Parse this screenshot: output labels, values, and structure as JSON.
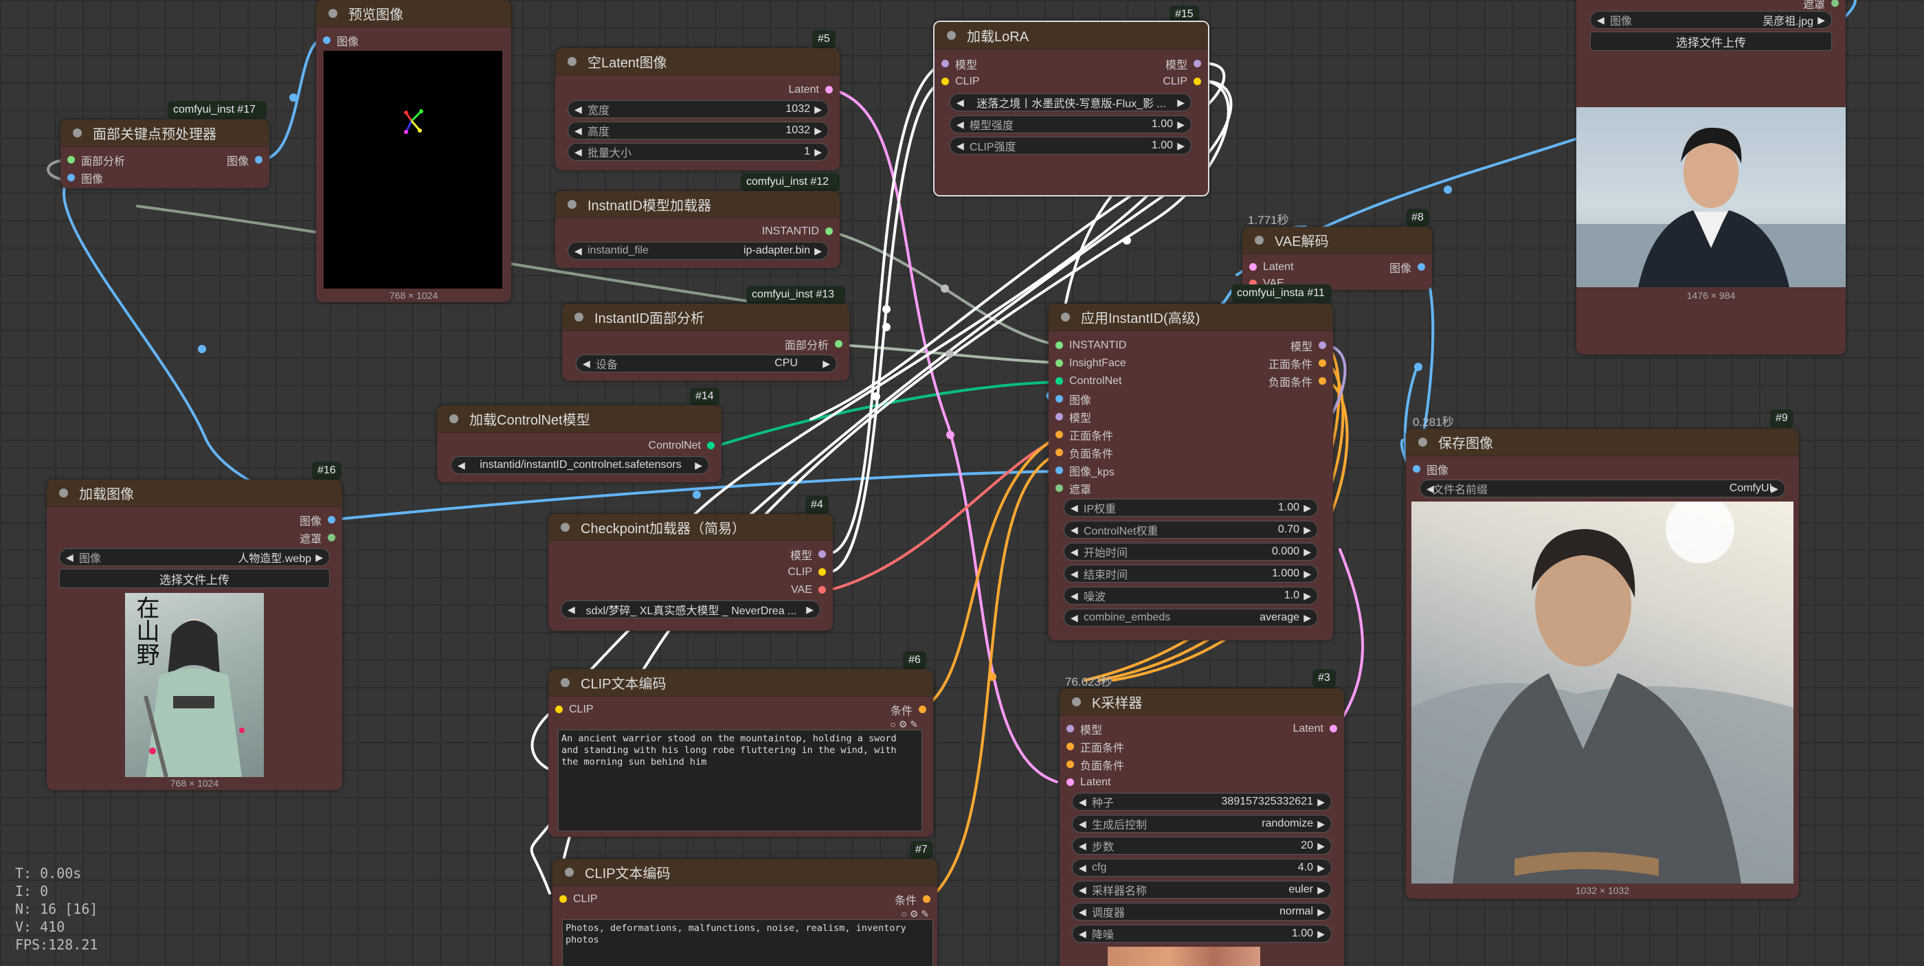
{
  "sockets": {
    "face_analysis": "面部分析",
    "image": "图像",
    "latent": "Latent",
    "instantid": "INSTANTID",
    "model": "模型",
    "clip": "CLIP",
    "vae": "VAE",
    "controlnet": "ControlNet",
    "mask": "遮罩",
    "positive": "正面条件",
    "negative": "负面条件",
    "insightface": "InsightFace",
    "image_kps": "图像_kps",
    "conditioning": "条件"
  },
  "n17": {
    "title": "面部关键点预处理器",
    "badge": "comfyui_inst #17"
  },
  "preview": {
    "title": "预览图像",
    "cap": "768 × 1024"
  },
  "n5": {
    "title": "空Latent图像",
    "badge": "#5",
    "width_l": "宽度",
    "width_v": "1032",
    "height_l": "高度",
    "height_v": "1032",
    "batch_l": "批量大小",
    "batch_v": "1"
  },
  "n12": {
    "title": "InstnatID模型加载器",
    "badge": "comfyui_inst #12",
    "file_l": "instantid_file",
    "file_v": "ip-adapter.bin"
  },
  "n13": {
    "title": "InstantID面部分析",
    "badge": "comfyui_inst #13",
    "dev_l": "设备",
    "dev_v": "CPU"
  },
  "n14": {
    "title": "加载ControlNet模型",
    "badge": "#14",
    "cn_v": "instantid/instantID_controlnet.safetensors"
  },
  "n16": {
    "title": "加载图像",
    "badge": "#16",
    "img_l": "图像",
    "img_v": "人物造型.webp",
    "upload": "选择文件上传",
    "cap": "768 × 1024",
    "poster": "在山野"
  },
  "n4": {
    "title": "Checkpoint加载器（简易）",
    "badge": "#4",
    "ckpt": "sdxl/梦碎_ XL真实感大模型 _ NeverDrea ..."
  },
  "n15": {
    "title": "加载LoRA",
    "badge": "#15",
    "lora": "迷落之境丨水墨武侠-写意版-Flux_影 ...",
    "ms_l": "模型强度",
    "ms_v": "1.00",
    "cs_l": "CLIP强度",
    "cs_v": "1.00"
  },
  "n6": {
    "title": "CLIP文本编码",
    "badge": "#6",
    "text": "An ancient warrior stood on the mountaintop, holding a sword and standing with his long robe fluttering in the wind, with the morning sun behind him"
  },
  "n7": {
    "title": "CLIP文本编码",
    "badge": "#7",
    "text": "Photos, deformations, malfunctions, noise, realism, inventory photos"
  },
  "n8": {
    "title": "VAE解码",
    "badge": "#8",
    "timing": "1.771秒"
  },
  "n11": {
    "title": "应用InstantID(高级)",
    "badge": "comfyui_insta #11",
    "ip_l": "IP权重",
    "ip_v": "1.00",
    "cnw_l": "ControlNet权重",
    "cnw_v": "0.70",
    "st_l": "开始时间",
    "st_v": "0.000",
    "et_l": "结束时间",
    "et_v": "1.000",
    "noise_l": "噪波",
    "noise_v": "1.0",
    "ce_l": "combine_embeds",
    "ce_v": "average"
  },
  "n3": {
    "title": "K采样器",
    "badge": "#3",
    "timing": "76.623秒",
    "seed_l": "种子",
    "seed_v": "389157325332621",
    "ctl_l": "生成后控制",
    "ctl_v": "randomize",
    "steps_l": "步数",
    "steps_v": "20",
    "cfg_l": "cfg",
    "cfg_v": "4.0",
    "samp_l": "采样器名称",
    "samp_v": "euler",
    "sch_l": "调度器",
    "sch_v": "normal",
    "den_l": "降噪",
    "den_v": "1.00"
  },
  "n9": {
    "title": "保存图像",
    "badge": "#9",
    "timing": "0.281秒",
    "prefix_l": "文件名前缀",
    "prefix_v": "ComfyUI",
    "cap": "1032 × 1032"
  },
  "ref": {
    "img_l": "图像",
    "img_v": "吴彦祖.jpg",
    "upload": "选择文件上传",
    "cap": "1476 × 984",
    "mask_l": "遮罩"
  },
  "stats": {
    "t": "T: 0.00s",
    "i": "I: 0",
    "n": "N: 16 [16]",
    "v": "V: 410",
    "fps": "FPS:128.21"
  },
  "colors": {
    "image": "#64b5f6",
    "latent": "#ff9cf9",
    "model": "#b39ddb",
    "clip": "#ffd500",
    "vae": "#ff6e6e",
    "cond": "#ffa931",
    "controlnet": "#00d78d",
    "face": "#7fe07f",
    "mask": "#81c784"
  }
}
